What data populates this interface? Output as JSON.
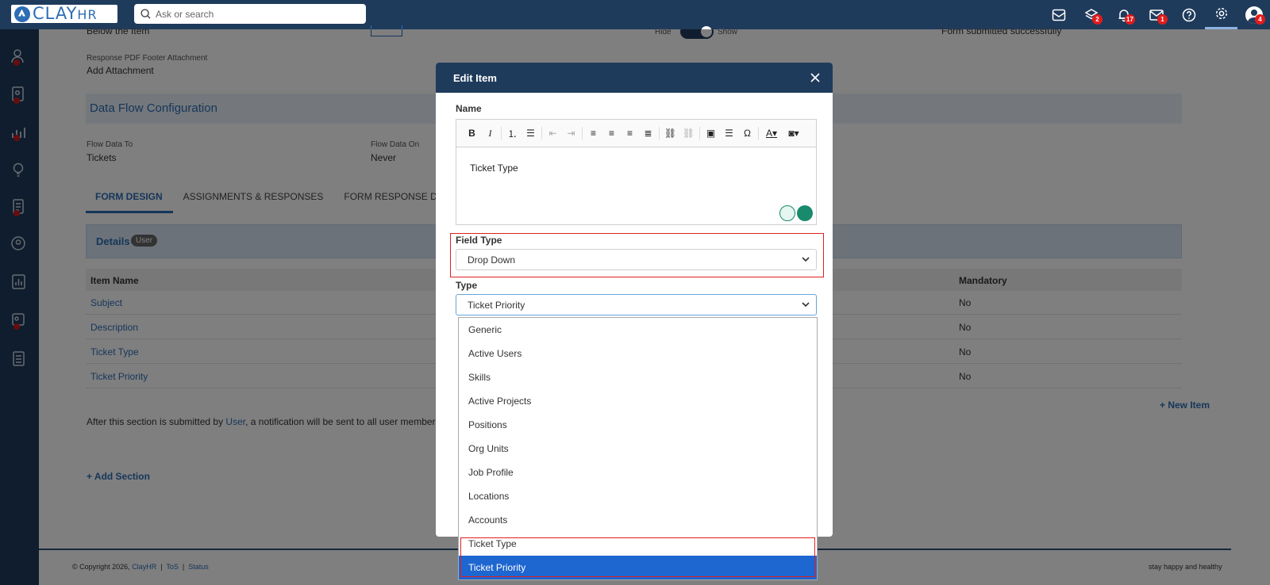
{
  "topbar": {
    "logo_text": "CLAY",
    "logo_suffix": "HR",
    "search_placeholder": "Ask or search",
    "badges": {
      "layers": "2",
      "notifications": "17",
      "mail": "1",
      "profile": "4"
    }
  },
  "background": {
    "below_item": "Below the Item",
    "hide": "Hide",
    "show": "Show",
    "form_submitted": "Form submitted successfully",
    "pdf_footer_label": "Response PDF Footer Attachment",
    "add_attachment": "Add Attachment",
    "data_flow_title": "Data Flow Configuration",
    "flow_to_label": "Flow Data To",
    "flow_to_value": "Tickets",
    "flow_on_label": "Flow Data On",
    "flow_on_value": "Never",
    "tabs": [
      "FORM DESIGN",
      "ASSIGNMENTS & RESPONSES",
      "FORM RESPONSE DATA"
    ],
    "details_title": "Details",
    "details_badge": "User",
    "col_item_name": "Item Name",
    "col_mandatory": "Mandatory",
    "rows": [
      {
        "name": "Subject",
        "mandatory": "No"
      },
      {
        "name": "Description",
        "mandatory": "No"
      },
      {
        "name": "Ticket Type",
        "mandatory": "No"
      },
      {
        "name": "Ticket Priority",
        "mandatory": "No"
      }
    ],
    "new_item": "+ New Item",
    "after_text_1": "After this section is submitted by ",
    "after_text_link": "User",
    "after_text_2": ", a notification will be sent to all user members of",
    "add_section": "+ Add Section",
    "copyright": "© Copyright 2026, ",
    "copyright_link": "ClayHR",
    "tos": "ToS",
    "status": "Status",
    "tagline": "stay happy and healthy"
  },
  "modal": {
    "title": "Edit Item",
    "name_label": "Name",
    "editor_text": "Ticket Type",
    "field_type_label": "Field Type",
    "field_type_value": "Drop Down",
    "type_label": "Type",
    "type_value": "Ticket Priority"
  },
  "dropdown": {
    "options": [
      "Generic",
      "Active Users",
      "Skills",
      "Active Projects",
      "Positions",
      "Org Units",
      "Job Profile",
      "Locations",
      "Accounts",
      "Ticket Type",
      "Ticket Priority"
    ],
    "selected": "Ticket Priority"
  }
}
